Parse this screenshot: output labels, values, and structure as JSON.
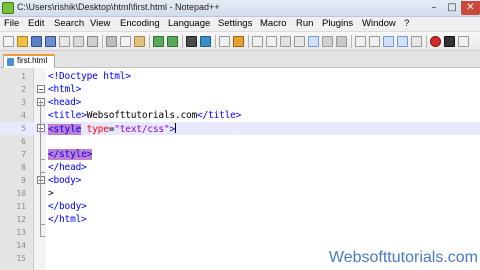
{
  "window": {
    "title": "C:\\Users\\rishik\\Desktop\\html\\first.html - Notepad++",
    "min_glyph": "–",
    "max_glyph": "□",
    "close_glyph": "✕"
  },
  "menu": [
    "File",
    "Edit",
    "Search",
    "View",
    "Encoding",
    "Language",
    "Settings",
    "Macro",
    "Run",
    "Plugins",
    "Window",
    "?"
  ],
  "tab": {
    "label": "first.html"
  },
  "editor": {
    "current_line": 5,
    "lines": [
      {
        "num": "1",
        "segments": [
          {
            "t": "<!Doctype html>",
            "c": "tag"
          }
        ]
      },
      {
        "num": "2",
        "segments": [
          {
            "t": "<html>",
            "c": "tag"
          }
        ]
      },
      {
        "num": "3",
        "segments": [
          {
            "t": "<head>",
            "c": "tag"
          }
        ]
      },
      {
        "num": "4",
        "segments": [
          {
            "t": "<title>",
            "c": "tag"
          },
          {
            "t": "Websofttutorials.com",
            "c": "txt"
          },
          {
            "t": "</title>",
            "c": "tag"
          }
        ]
      },
      {
        "num": "5",
        "segments": [
          {
            "t": "<style",
            "c": "tag"
          },
          {
            "t": " type",
            "c": "attr"
          },
          {
            "t": "=",
            "c": "txt"
          },
          {
            "t": "\"text/css\"",
            "c": "str"
          },
          {
            "t": ">",
            "c": "tag"
          }
        ]
      },
      {
        "num": "6",
        "segments": []
      },
      {
        "num": "7",
        "segments": [
          {
            "t": "</style>",
            "c": "tag"
          }
        ]
      },
      {
        "num": "8",
        "segments": [
          {
            "t": "</head>",
            "c": "tag"
          }
        ]
      },
      {
        "num": "9",
        "segments": [
          {
            "t": "<body>",
            "c": "tag"
          }
        ]
      },
      {
        "num": "10",
        "segments": [
          {
            "t": ">",
            "c": "txt"
          }
        ]
      },
      {
        "num": "11",
        "segments": [
          {
            "t": "</body>",
            "c": "tag"
          }
        ]
      },
      {
        "num": "12",
        "segments": [
          {
            "t": "</html>",
            "c": "tag"
          }
        ]
      },
      {
        "num": "13",
        "segments": []
      },
      {
        "num": "14",
        "segments": []
      },
      {
        "num": "15",
        "segments": []
      }
    ]
  },
  "watermark": "Websofttutorials.com",
  "colors": {
    "tag": "#0000ff",
    "attr": "#ff0000",
    "string": "#8000ff",
    "highlight": "#c07fd0",
    "current_line": "#e8e8ff"
  }
}
